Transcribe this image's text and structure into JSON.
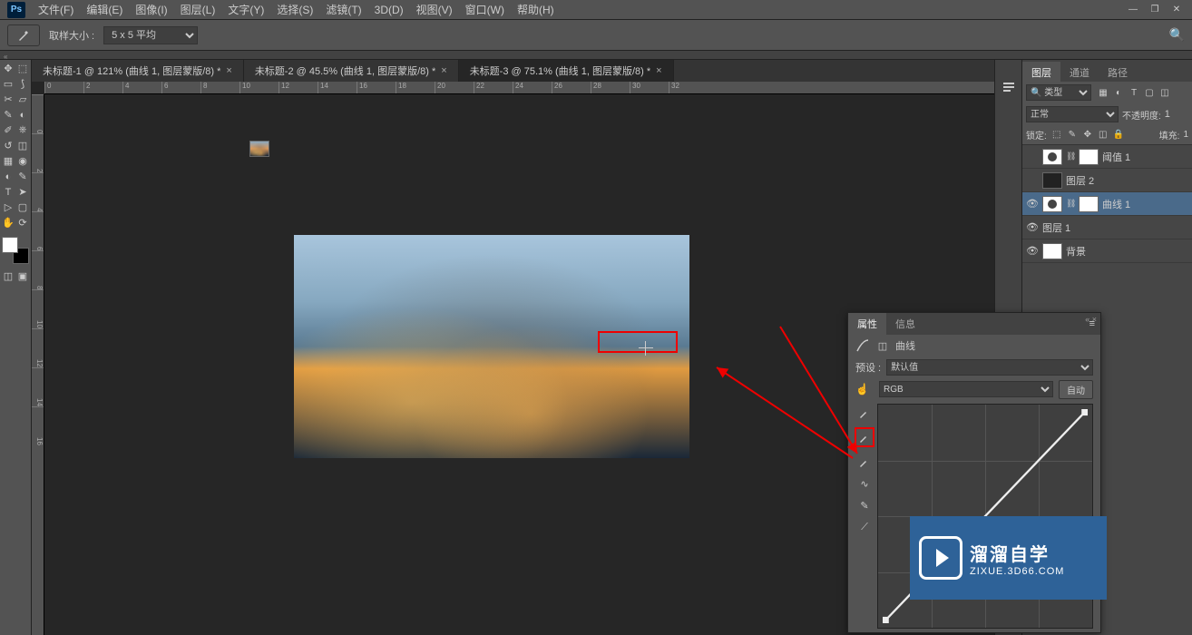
{
  "menubar": {
    "items": [
      "文件(F)",
      "编辑(E)",
      "图像(I)",
      "图层(L)",
      "文字(Y)",
      "选择(S)",
      "滤镜(T)",
      "3D(D)",
      "视图(V)",
      "窗口(W)",
      "帮助(H)"
    ]
  },
  "optionsbar": {
    "sample_label": "取样大小 :",
    "sample_value": "5 x 5 平均"
  },
  "tabs": [
    {
      "label": "未标题-1 @ 121% (曲线 1, 图层蒙版/8) *"
    },
    {
      "label": "未标题-2 @ 45.5% (曲线 1, 图层蒙版/8) *"
    },
    {
      "label": "未标题-3 @ 75.1% (曲线 1, 图层蒙版/8) *"
    }
  ],
  "active_tab": 2,
  "ruler_h": [
    "0",
    "2",
    "4",
    "6",
    "8",
    "10",
    "12",
    "14",
    "16",
    "18",
    "20",
    "22",
    "24",
    "26",
    "28",
    "30",
    "32"
  ],
  "ruler_v": [
    "0",
    "2",
    "4",
    "6",
    "8",
    "10",
    "12",
    "14",
    "16"
  ],
  "panels": {
    "tabs": [
      "图层",
      "通道",
      "路径"
    ],
    "filter_label": "类型",
    "blend_mode": "正常",
    "opacity_label": "不透明度:",
    "opacity_value": "1",
    "lock_label": "锁定:",
    "fill_label": "填充:",
    "fill_value": "1",
    "layers": [
      {
        "visible": false,
        "thumb": "circle",
        "mask": true,
        "name": "阈值 1",
        "selected": false
      },
      {
        "visible": false,
        "thumb": "gray",
        "mask": false,
        "name": "图层 2",
        "selected": false
      },
      {
        "visible": true,
        "thumb": "circle",
        "mask": true,
        "name": "曲线 1",
        "selected": true
      },
      {
        "visible": true,
        "thumb": "photo",
        "mask": false,
        "name": "图层 1",
        "selected": false
      },
      {
        "visible": true,
        "thumb": "white",
        "mask": false,
        "name": "背景",
        "selected": false
      }
    ]
  },
  "properties": {
    "tabs": [
      "属性",
      "信息"
    ],
    "type_label": "曲线",
    "preset_label": "预设 :",
    "preset_value": "默认值",
    "channel_value": "RGB",
    "auto_label": "自动",
    "collapse": "«  ×"
  },
  "watermark": {
    "line1": "溜溜自学",
    "line2": "ZIXUE.3D66.COM"
  }
}
